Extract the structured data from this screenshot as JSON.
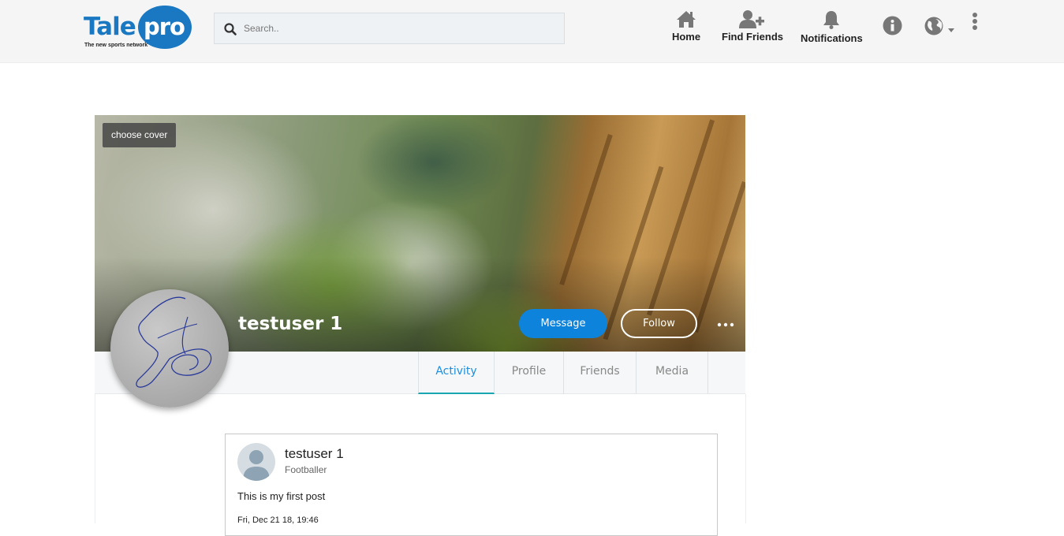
{
  "header": {
    "logo": {
      "word1": "Tale",
      "word2": "pro",
      "tagline": "The new sports network"
    },
    "search": {
      "placeholder": "Search.."
    },
    "nav": {
      "home_label": "Home",
      "find_friends_label": "Find Friends",
      "notifications_label": "Notifications"
    },
    "icons": [
      "home-icon",
      "add-user-icon",
      "bell-icon",
      "info-icon",
      "globe-icon",
      "more-vertical-icon"
    ]
  },
  "profile": {
    "choose_cover_label": "choose cover",
    "name": "testuser 1",
    "message_label": "Message",
    "follow_label": "Follow",
    "tabs": [
      {
        "label": "Activity",
        "active": true
      },
      {
        "label": "Profile",
        "active": false
      },
      {
        "label": "Friends",
        "active": false
      },
      {
        "label": "Media",
        "active": false
      }
    ]
  },
  "post": {
    "author": "testuser 1",
    "role": "Footballer",
    "text": "This is my first post",
    "date": "Fri, Dec 21 18, 19:46"
  },
  "colors": {
    "brand_blue": "#1a78c2",
    "message_button": "#0e83dc",
    "active_tab": "#1a8fe0",
    "header_bg": "#f5f5f5"
  }
}
